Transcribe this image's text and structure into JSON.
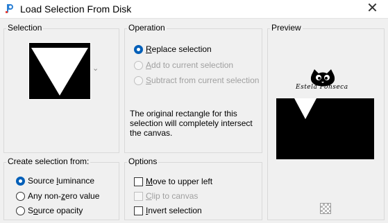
{
  "window": {
    "title": "Load Selection From Disk",
    "close_glyph": "✕",
    "icon": "paintshop-icon"
  },
  "selection": {
    "title": "Selection",
    "dropdown_glyph": "⌄"
  },
  "operation": {
    "title": "Operation",
    "options": [
      {
        "pre": "",
        "ul": "R",
        "post": "eplace selection",
        "selected": true,
        "enabled": true
      },
      {
        "pre": "",
        "ul": "A",
        "post": "dd to current selection",
        "selected": false,
        "enabled": false
      },
      {
        "pre": "",
        "ul": "S",
        "post": "ubtract from current selection",
        "selected": false,
        "enabled": false
      }
    ],
    "message": "The original rectangle for this selection will completely intersect the canvas."
  },
  "preview": {
    "title": "Preview",
    "watermark": "Estela Fonseca",
    "toggle_icon": "checkerboard-icon"
  },
  "create": {
    "title": "Create selection from:",
    "options": [
      {
        "pre": "Source ",
        "ul": "l",
        "post": "uminance",
        "selected": true
      },
      {
        "pre": "Any non-",
        "ul": "z",
        "post": "ero value",
        "selected": false
      },
      {
        "pre": "S",
        "ul": "o",
        "post": "urce opacity",
        "selected": false
      }
    ]
  },
  "options": {
    "title": "Options",
    "items": [
      {
        "pre": "",
        "ul": "M",
        "post": "ove to upper left",
        "checked": false,
        "enabled": true
      },
      {
        "pre": "",
        "ul": "C",
        "post": "lip to canvas",
        "checked": false,
        "enabled": false
      },
      {
        "pre": "",
        "ul": "I",
        "post": "nvert selection",
        "checked": false,
        "enabled": true
      }
    ]
  },
  "colors": {
    "accent": "#005fb8",
    "window_bg": "#f0f0f0",
    "disabled_text": "#a0a0a0"
  }
}
